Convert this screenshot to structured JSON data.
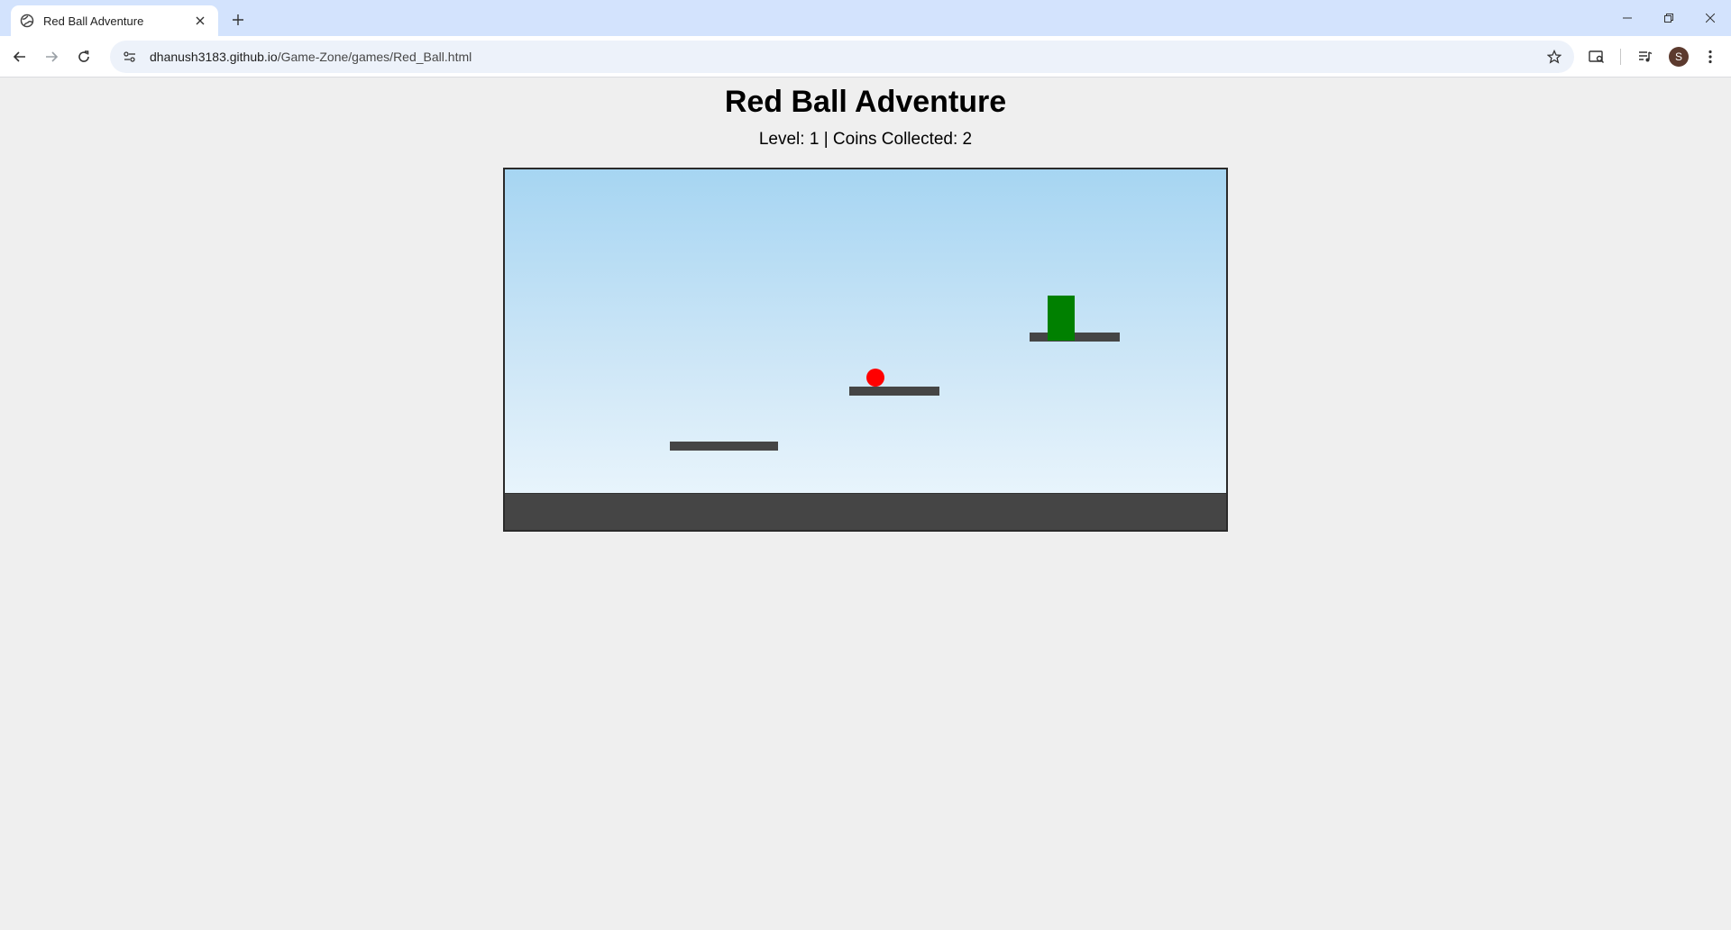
{
  "browser": {
    "tab_title": "Red Ball Adventure",
    "url_host": "dhanush3183.github.io",
    "url_path": "/Game-Zone/games/Red_Ball.html",
    "avatar_letter": "S"
  },
  "game": {
    "title": "Red Ball Adventure",
    "level_label": "Level:",
    "level": "1",
    "separator": "|",
    "coins_label": "Coins Collected:",
    "coins": "2",
    "colors": {
      "ball": "#ff0000",
      "goal": "#008000",
      "platform": "#454545",
      "sky_top": "#a6d5f2",
      "sky_bottom": "#eff8fd"
    }
  },
  "icons": [
    "globe-icon",
    "close-icon",
    "plus-icon",
    "minimize-icon",
    "restore-icon",
    "back-icon",
    "forward-icon",
    "reload-icon",
    "site-info-icon",
    "star-icon",
    "search-tab-icon",
    "media-icon",
    "more-icon"
  ]
}
